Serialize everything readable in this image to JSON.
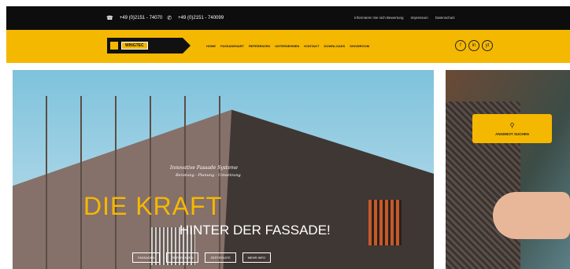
{
  "topbar": {
    "phone1": "+49 (0)2151 - 74070",
    "phone2": "+49 (0)2151 - 740099",
    "links": [
      "Informieren Sie sich Bewertung",
      "Impressum",
      "Datenschutz"
    ]
  },
  "brand": {
    "logo_text": "WINGTEC"
  },
  "menu": [
    "HOME",
    "FASSADENART",
    "REFERENZEN",
    "UNTERNEHMEN",
    "KONTAKT",
    "DOWNLOADS",
    "SHOWROOM"
  ],
  "social": [
    "f",
    "in",
    "yt"
  ],
  "hero": {
    "script_line1": "Innovative Fassade Systeme",
    "script_line2": "Beratung · Planung · Umsetzung",
    "title_line1": "DIE KRAFT",
    "title_line2": "HINTER DER FASSADE!",
    "buttons": [
      "FASSADEN",
      "REFERENZEN",
      "ZERTIFIKATE",
      "MEHR INFO"
    ]
  },
  "side": {
    "cta_icon": "search-icon",
    "cta_label": "ANGEBOT SUCHEN"
  },
  "colors": {
    "brand_yellow": "#f5b800",
    "topbar_black": "#0d0d0d"
  }
}
